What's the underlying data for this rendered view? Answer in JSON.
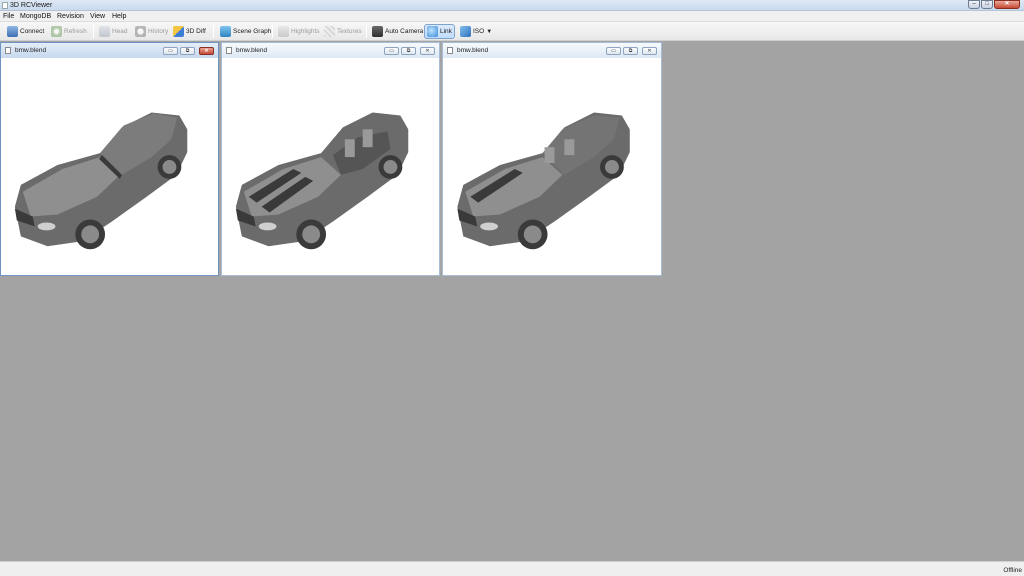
{
  "window": {
    "title": "3D RCViewer",
    "min_glyph": "‒",
    "max_glyph": "□",
    "close_glyph": "✕"
  },
  "menu": [
    "File",
    "MongoDB",
    "Revision",
    "View",
    "Help"
  ],
  "toolbar": {
    "connect": "Connect",
    "refresh": "Refresh",
    "head": "Head",
    "history": "History",
    "diff": "3D Diff",
    "scene_graph": "Scene Graph",
    "highlights": "Highlights",
    "textures": "Textures",
    "auto_camera": "Auto Camera",
    "link": "Link",
    "iso": "ISO",
    "iso_caret": "▼"
  },
  "subwindows": [
    {
      "name": "bmw.blend",
      "variant": "coupe",
      "focused": true
    },
    {
      "name": "bmw.blend",
      "variant": "convertible",
      "focused": false
    },
    {
      "name": "bmw.blend",
      "variant": "diff",
      "focused": false
    }
  ],
  "mdi_glyphs": {
    "min": "▭",
    "restore": "⧉",
    "close": "✕"
  },
  "status": {
    "text": "Offline"
  },
  "colors": {
    "workspace": "#a3a3a3",
    "car_body": "#6b6b6b",
    "car_dark": "#3a3a3a",
    "car_light": "#8f8f8f"
  }
}
